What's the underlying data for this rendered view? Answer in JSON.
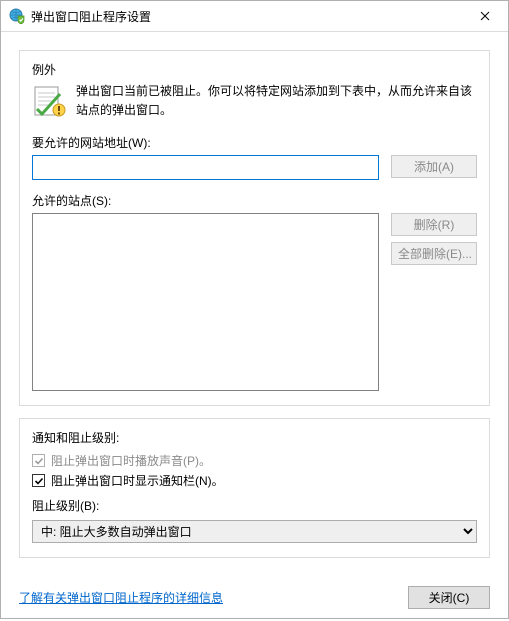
{
  "title": "弹出窗口阻止程序设置",
  "exceptions": {
    "legend": "例外",
    "description": "弹出窗口当前已被阻止。你可以将特定网站添加到下表中，从而允许来自该站点的弹出窗口。",
    "address_label": "要允许的网站地址(W):",
    "address_value": "",
    "add_label": "添加(A)",
    "allowed_label": "允许的站点(S):",
    "remove_label": "删除(R)",
    "remove_all_label": "全部删除(E)...",
    "allowed_items": []
  },
  "settings": {
    "legend": "通知和阻止级别:",
    "play_sound_label": "阻止弹出窗口时播放声音(P)。",
    "show_bar_label": "阻止弹出窗口时显示通知栏(N)。",
    "level_label": "阻止级别(B):",
    "level_value": "中: 阻止大多数自动弹出窗口"
  },
  "link_label": "了解有关弹出窗口阻止程序的详细信息",
  "close_label": "关闭(C)"
}
